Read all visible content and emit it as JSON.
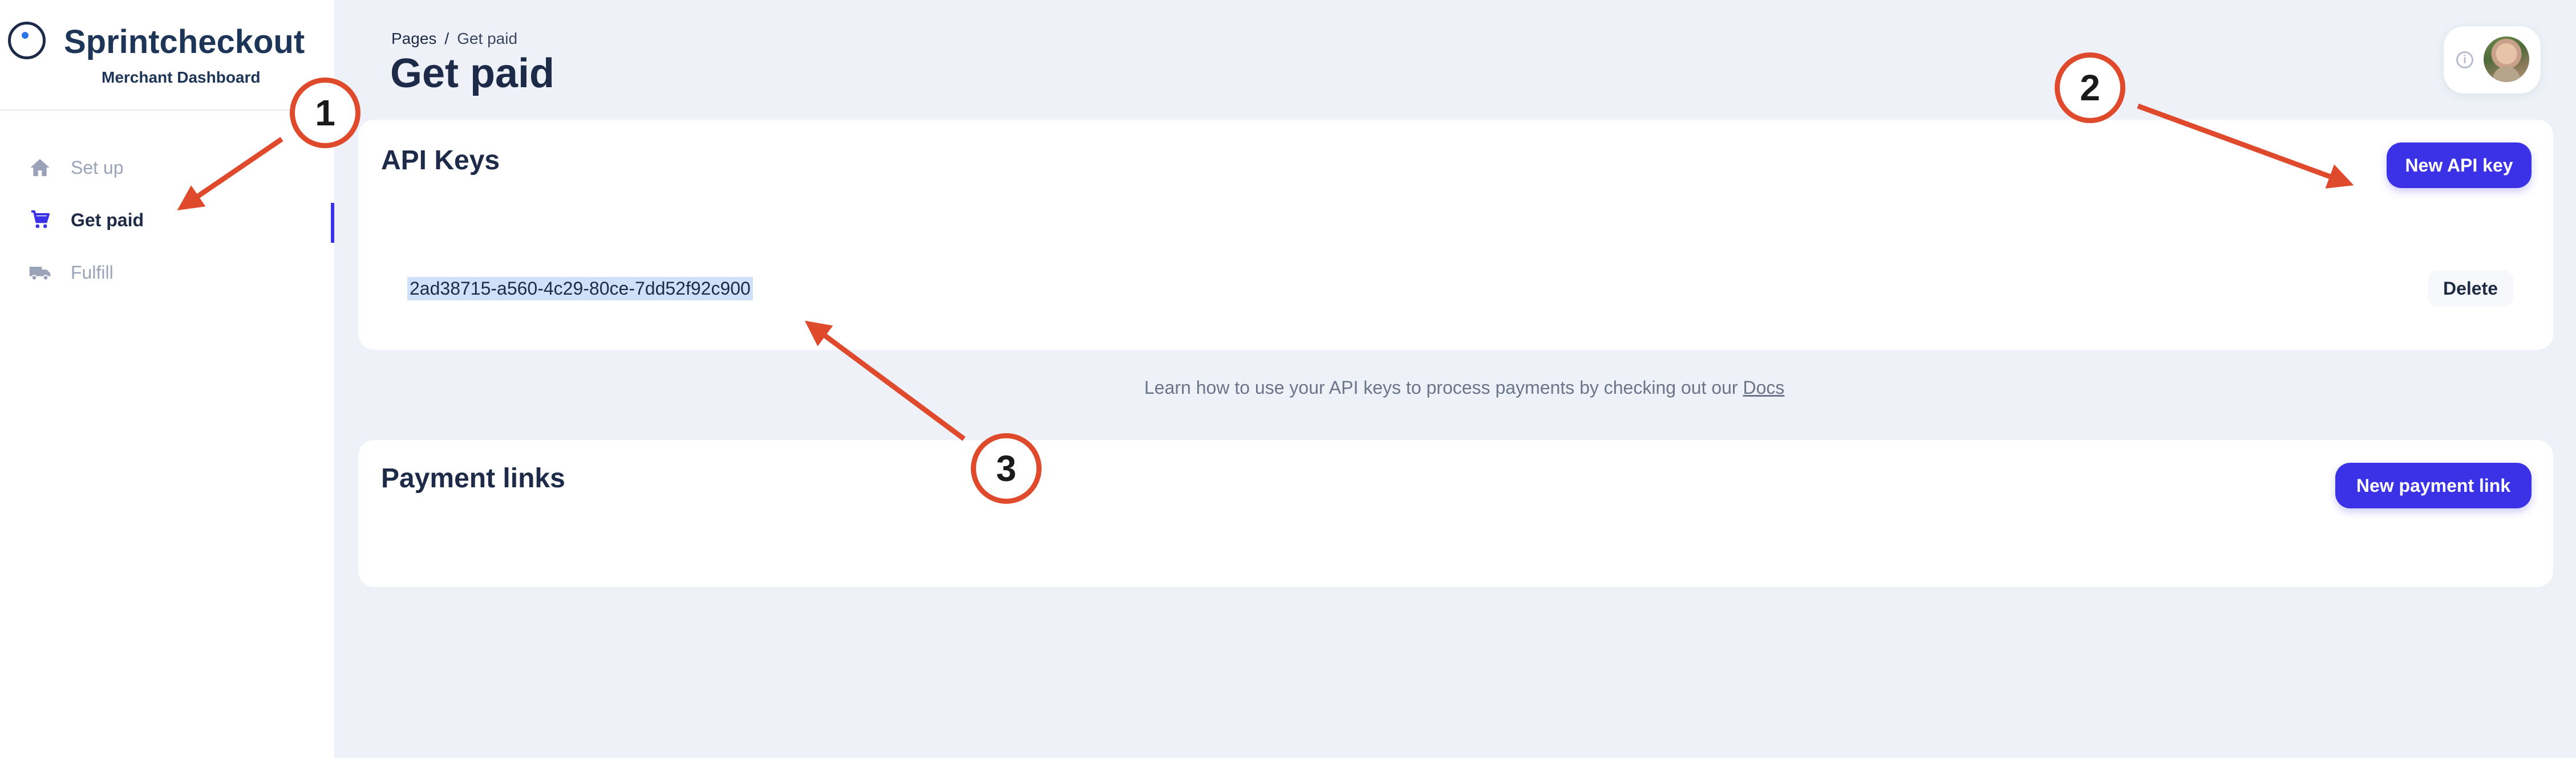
{
  "brand": {
    "name": "Sprintcheckout",
    "subtitle": "Merchant Dashboard"
  },
  "sidebar": {
    "items": [
      {
        "label": "Set up",
        "icon": "home-icon",
        "active": false
      },
      {
        "label": "Get paid",
        "icon": "cart-icon",
        "active": true
      },
      {
        "label": "Fulfill",
        "icon": "truck-icon",
        "active": false
      }
    ]
  },
  "header": {
    "breadcrumb_root": "Pages",
    "breadcrumb_separator": "/",
    "breadcrumb_current": "Get paid",
    "title": "Get paid"
  },
  "api_keys": {
    "title": "API Keys",
    "new_button": "New API key",
    "keys": [
      {
        "value": "2ad38715-a560-4c29-80ce-7dd52f92c900",
        "delete_label": "Delete"
      }
    ]
  },
  "docs_note": {
    "text": "Learn how to use your API keys to process payments by checking out our ",
    "link": "Docs"
  },
  "payment_links": {
    "title": "Payment links",
    "new_button": "New payment link"
  },
  "annotations": [
    "1",
    "2",
    "3"
  ],
  "colors": {
    "accent": "#3b32e8",
    "annotation": "#e04a2c",
    "selection": "#cfe0fb",
    "background": "#eef2f8"
  }
}
